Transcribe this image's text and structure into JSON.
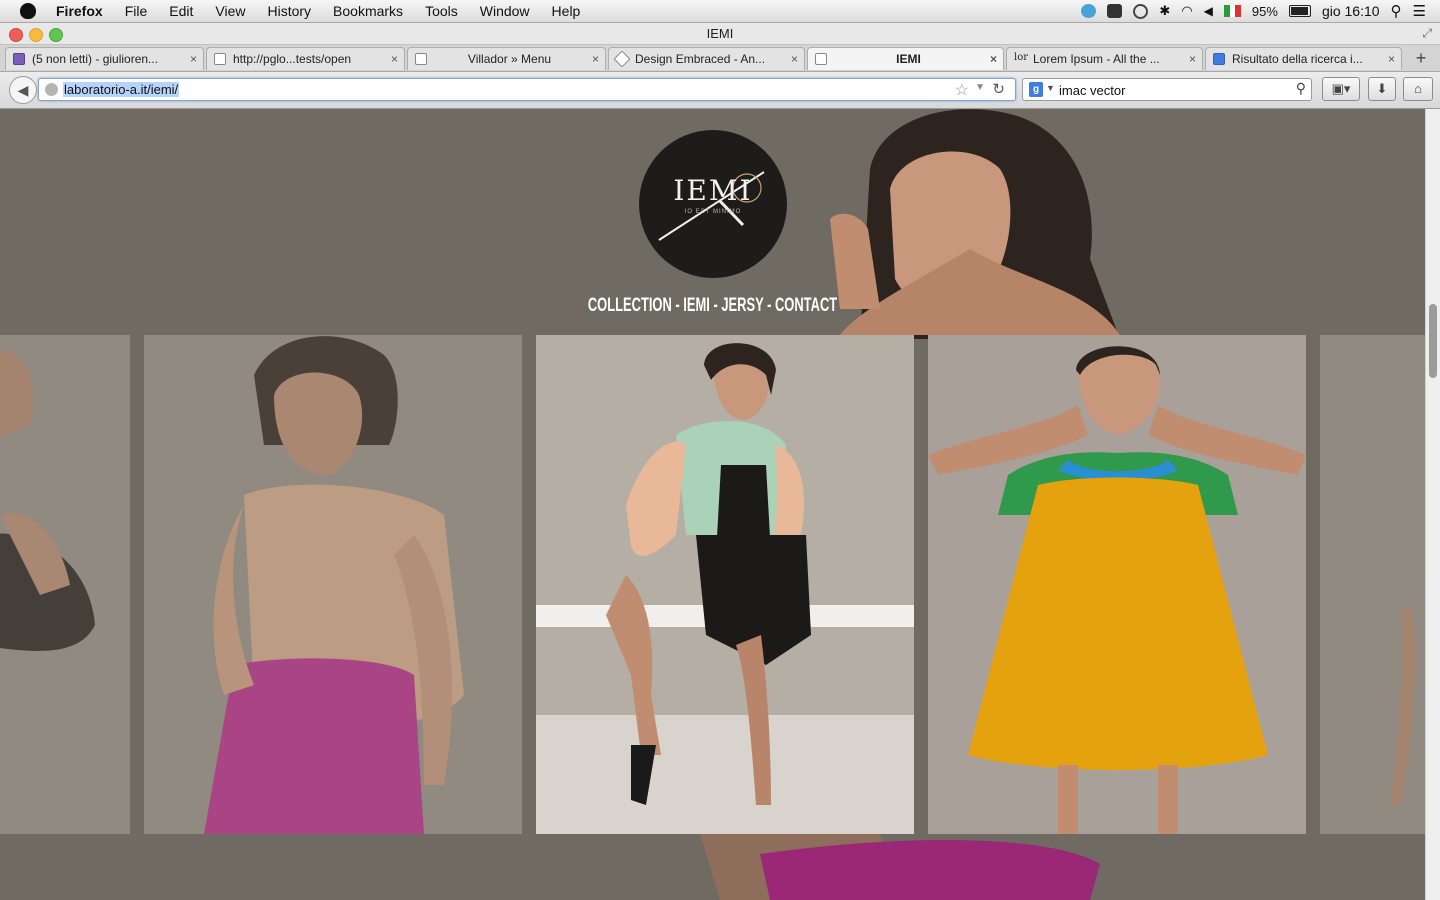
{
  "menubar": {
    "items": [
      "Firefox",
      "File",
      "Edit",
      "View",
      "History",
      "Bookmarks",
      "Tools",
      "Window",
      "Help"
    ],
    "battery": "95%",
    "clock": "gio 16:10"
  },
  "window": {
    "title": "IEMI"
  },
  "tabs": [
    {
      "label": "(5 non letti) - giulioren..."
    },
    {
      "label": "http://pglo...tests/open"
    },
    {
      "label": "Villador » Menu"
    },
    {
      "label": "Design Embraced - An..."
    },
    {
      "label": "IEMI"
    },
    {
      "label": "Lorem Ipsum - All the ..."
    },
    {
      "label": "Risultato della ricerca i..."
    }
  ],
  "newtab_label": "+",
  "urlbar": {
    "url": "laboratorio-a.it/iemi/"
  },
  "searchbar": {
    "value": "imac vector",
    "engine_glyph": "g"
  },
  "site": {
    "logo": {
      "wordmark": "IEMI",
      "subtitle": "IO EST MINIMO"
    },
    "nav": [
      "COLLECTION",
      "IEMI",
      "JERSY",
      "CONTACT"
    ],
    "separator": " - "
  },
  "colors": {
    "page_bg": "#6f6a62",
    "photo_bg": "#a59d93",
    "logo_bg": "#1e1c1b",
    "skirt_pink": "#c9339a",
    "dress_yellow": "#e3a20e",
    "sleeve_green": "#2f9a4c",
    "blouse_peach": "#e9b899",
    "vest_mint": "#a9d2b8"
  }
}
